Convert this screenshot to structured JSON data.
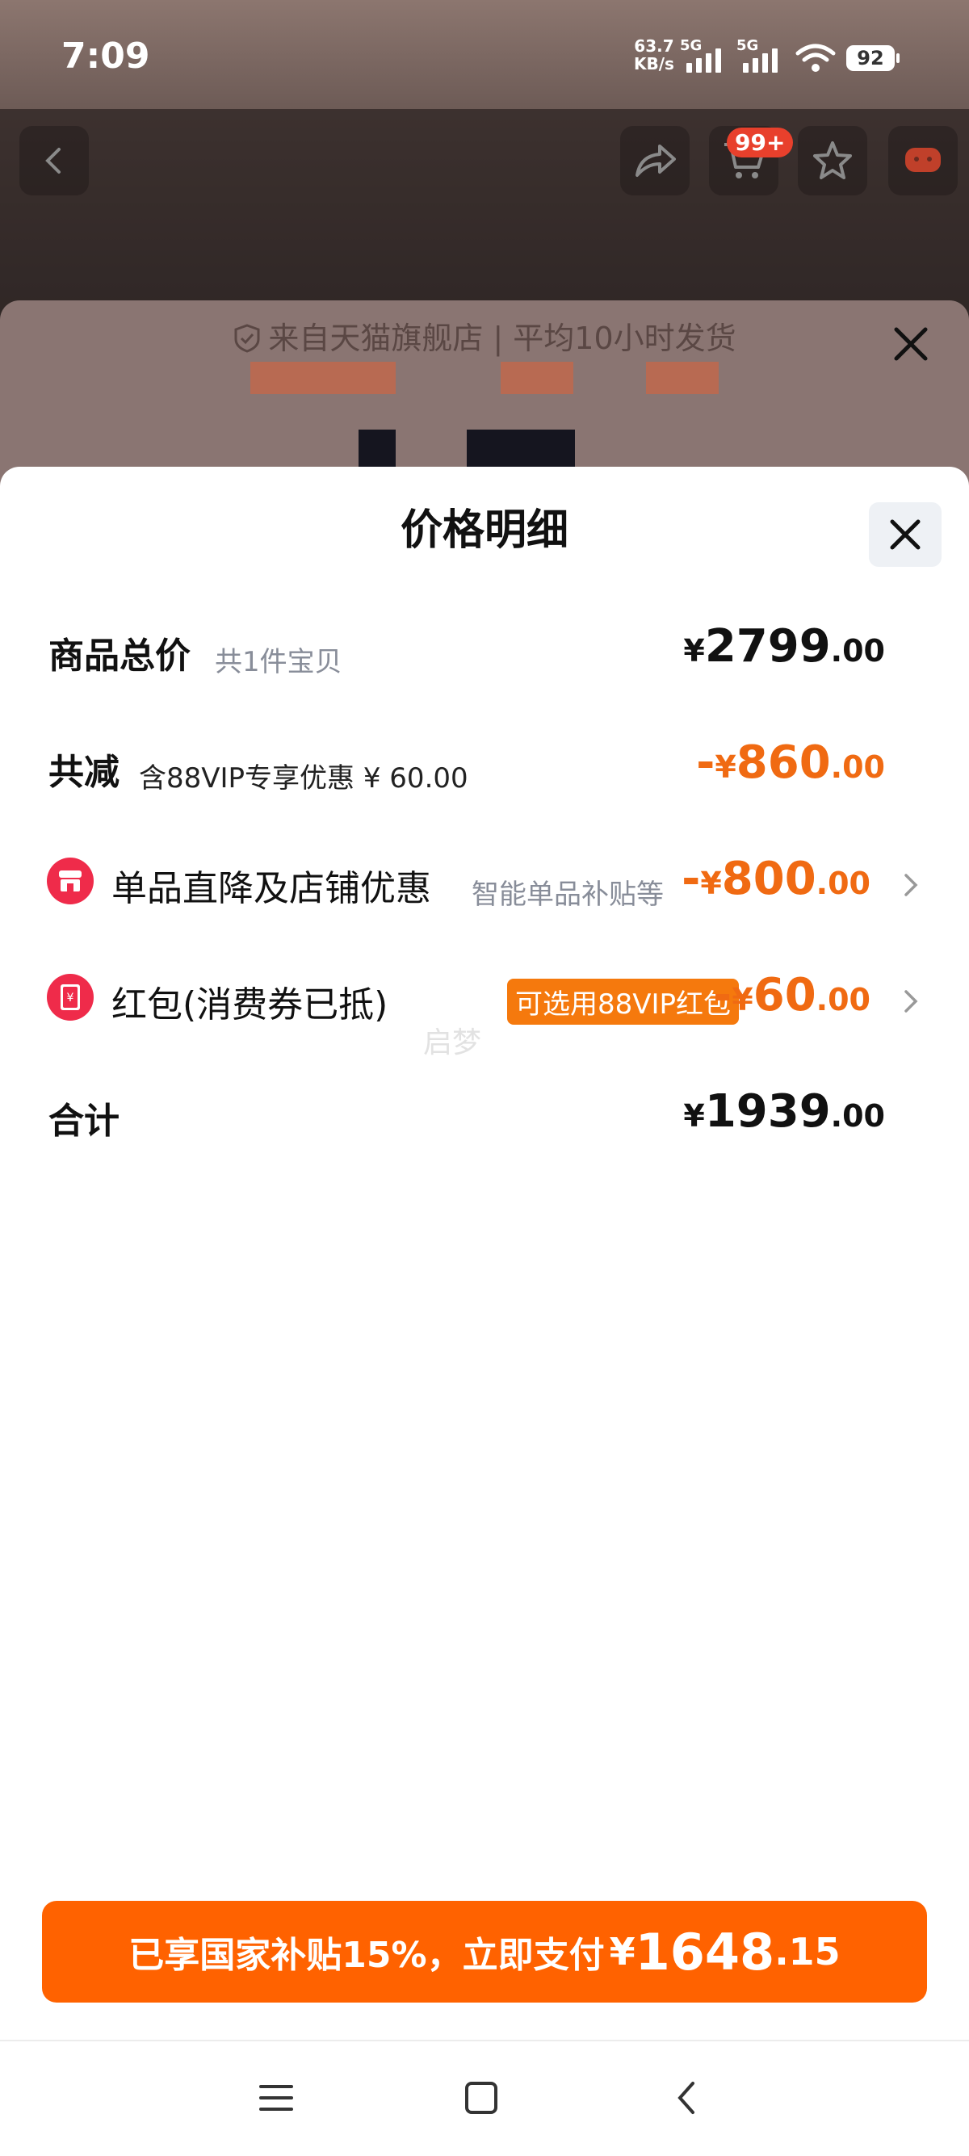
{
  "status": {
    "time": "7:09",
    "net_speed_value": "63.7",
    "net_speed_unit": "KB/s",
    "sim1": "5G",
    "sim2": "5G",
    "wifi_slot": "7",
    "battery": "92"
  },
  "nav": {
    "cart_badge": "99+"
  },
  "store_banner": {
    "text": "来自天猫旗舰店 | 平均10小时发货"
  },
  "sheet": {
    "title": "价格明细",
    "rows": [
      {
        "label": "商品总价",
        "sub": "共1件宝贝",
        "sign": "",
        "yen": "¥",
        "amount_int": "2799",
        "amount_dec": ".00"
      },
      {
        "label": "共减",
        "sub": "含88VIP专享优惠 ¥ 60.00",
        "sign": "-",
        "yen": "¥",
        "amount_int": "860",
        "amount_dec": ".00"
      },
      {
        "label": "单品直降及店铺优惠",
        "sub": "智能单品补贴等",
        "sign": "-",
        "yen": "¥",
        "amount_int": "800",
        "amount_dec": ".00"
      },
      {
        "label": "红包(消费券已抵)",
        "tag": "可选用88VIP红包",
        "sign": "-",
        "yen": "¥",
        "amount_int": "60",
        "amount_dec": ".00"
      },
      {
        "label": "合计",
        "sign": "",
        "yen": "¥",
        "amount_int": "1939",
        "amount_dec": ".00"
      }
    ],
    "watermark": "启梦"
  },
  "pay": {
    "text": "已享国家补贴15%，立即支付",
    "yen": "¥",
    "amount_int": "1648",
    "amount_dec": ".15"
  },
  "colors": {
    "accent_orange": "#ff6200",
    "discount_orange": "#f06a12",
    "coupon_red": "#ef2b4a"
  },
  "icons": [
    "back-icon",
    "share-icon",
    "cart-icon",
    "star-icon",
    "shield-icon",
    "close-icon",
    "store-icon",
    "red-packet-icon",
    "chevron-right-icon",
    "menu-icon",
    "home-square-icon",
    "back-chevron-icon"
  ]
}
